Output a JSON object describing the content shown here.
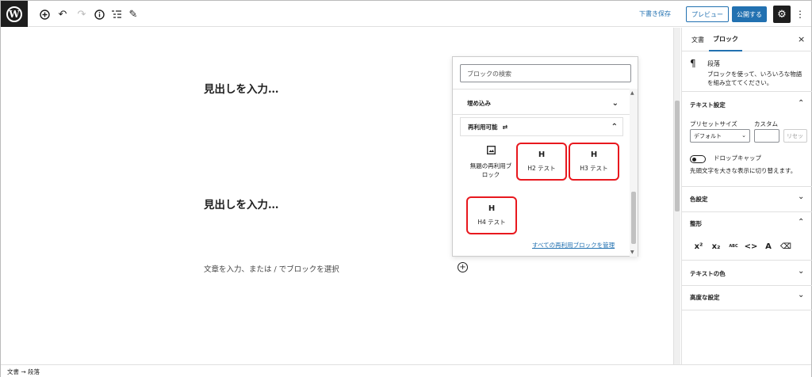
{
  "topbar": {
    "save_draft": "下書き保存",
    "preview": "プレビュー",
    "publish": "公開する",
    "icons": [
      "wordpress-logo",
      "add-block-icon",
      "undo-icon",
      "redo-icon",
      "info-icon",
      "list-view-icon",
      "edit-tools-icon",
      "settings-gear-icon",
      "more-options-icon"
    ]
  },
  "canvas": {
    "heading1": "見出しを入力…",
    "heading2": "見出しを入力…",
    "paragraph_placeholder": "文章を入力、または / でブロックを選択"
  },
  "inserter": {
    "search_placeholder": "ブロックの検索",
    "panels": [
      {
        "label": "埋め込み",
        "expanded": false
      },
      {
        "label": "再利用可能",
        "expanded": true
      }
    ],
    "blocks": [
      {
        "icon": "reusable-block-icon",
        "label": "無題の再利用ブロック",
        "highlighted": false
      },
      {
        "icon": "H",
        "label": "H2 テスト",
        "highlighted": true
      },
      {
        "icon": "H",
        "label": "H3 テスト",
        "highlighted": true
      },
      {
        "icon": "H",
        "label": "H4 テスト",
        "highlighted": true
      }
    ],
    "manage_link": "すべての再利用ブロックを管理",
    "highlight_color": "#e8181e"
  },
  "sidebar": {
    "tabs": [
      "文書",
      "ブロック"
    ],
    "active_tab": "ブロック",
    "block": {
      "title": "段落",
      "description": "ブロックを使って、いろいろな物語を組み立ててください。"
    },
    "text_settings": {
      "title": "テキスト設定",
      "preset_label": "プリセットサイズ",
      "custom_label": "カスタム",
      "preset_value": "デフォルト",
      "reset": "リセット",
      "dropcap_label": "ドロップキャップ",
      "dropcap_help": "先頭文字を大きな表示に切り替えます。"
    },
    "color_settings": "色設定",
    "formatting": "整形",
    "format_buttons": [
      "x²",
      "x₂",
      "ABC",
      "<>",
      "A",
      "⌫"
    ],
    "text_color": "テキストの色",
    "advanced": "高度な設定"
  },
  "footer": {
    "breadcrumb": "文書 → 段落"
  },
  "colors": {
    "accent": "#2271b1",
    "dark": "#1e1e1e"
  }
}
